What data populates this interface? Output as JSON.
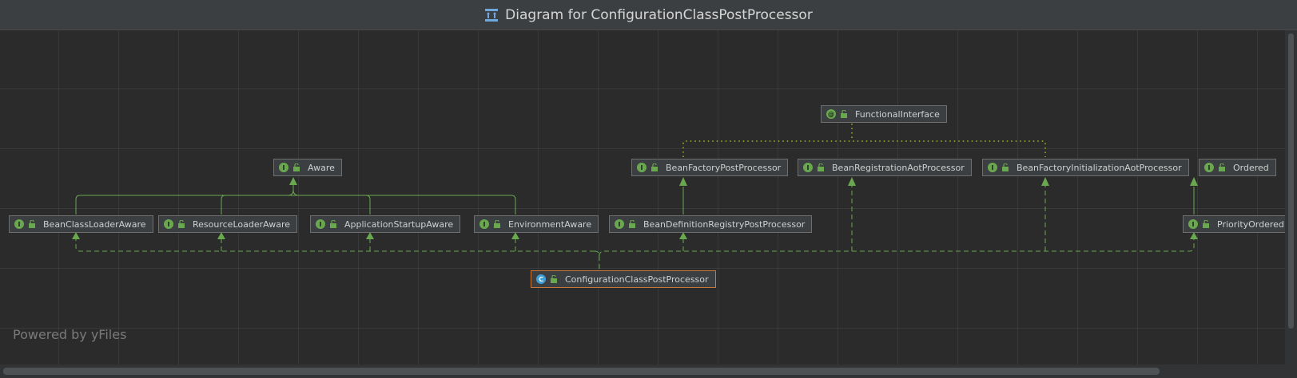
{
  "window": {
    "title": "Diagram for ConfigurationClassPostProcessor",
    "icon": "diagram-icon"
  },
  "watermark": "Powered by yFiles",
  "colors": {
    "background": "#2b2b2b",
    "node_fill": "#3c3f41",
    "inheritance_edge": "#6aa84f",
    "annotation_edge": "#a8b820",
    "selected_border": "#c8783c"
  },
  "nodes": {
    "functional_interface": {
      "label": "FunctionalInterface",
      "kind": "annotation"
    },
    "aware": {
      "label": "Aware",
      "kind": "interface"
    },
    "bean_factory_post_processor": {
      "label": "BeanFactoryPostProcessor",
      "kind": "interface"
    },
    "bean_registration_aot_processor": {
      "label": "BeanRegistrationAotProcessor",
      "kind": "interface"
    },
    "bean_factory_initialization_aot_processor": {
      "label": "BeanFactoryInitializationAotProcessor",
      "kind": "interface"
    },
    "ordered": {
      "label": "Ordered",
      "kind": "interface"
    },
    "bean_class_loader_aware": {
      "label": "BeanClassLoaderAware",
      "kind": "interface"
    },
    "resource_loader_aware": {
      "label": "ResourceLoaderAware",
      "kind": "interface"
    },
    "application_startup_aware": {
      "label": "ApplicationStartupAware",
      "kind": "interface"
    },
    "environment_aware": {
      "label": "EnvironmentAware",
      "kind": "interface"
    },
    "bean_definition_registry_post_processor": {
      "label": "BeanDefinitionRegistryPostProcessor",
      "kind": "interface"
    },
    "priority_ordered": {
      "label": "PriorityOrdered",
      "kind": "interface"
    },
    "configuration_class_post_processor": {
      "label": "ConfigurationClassPostProcessor",
      "kind": "class",
      "selected": true
    }
  },
  "badges": {
    "interface": "I",
    "annotation": "@",
    "class": "C"
  }
}
